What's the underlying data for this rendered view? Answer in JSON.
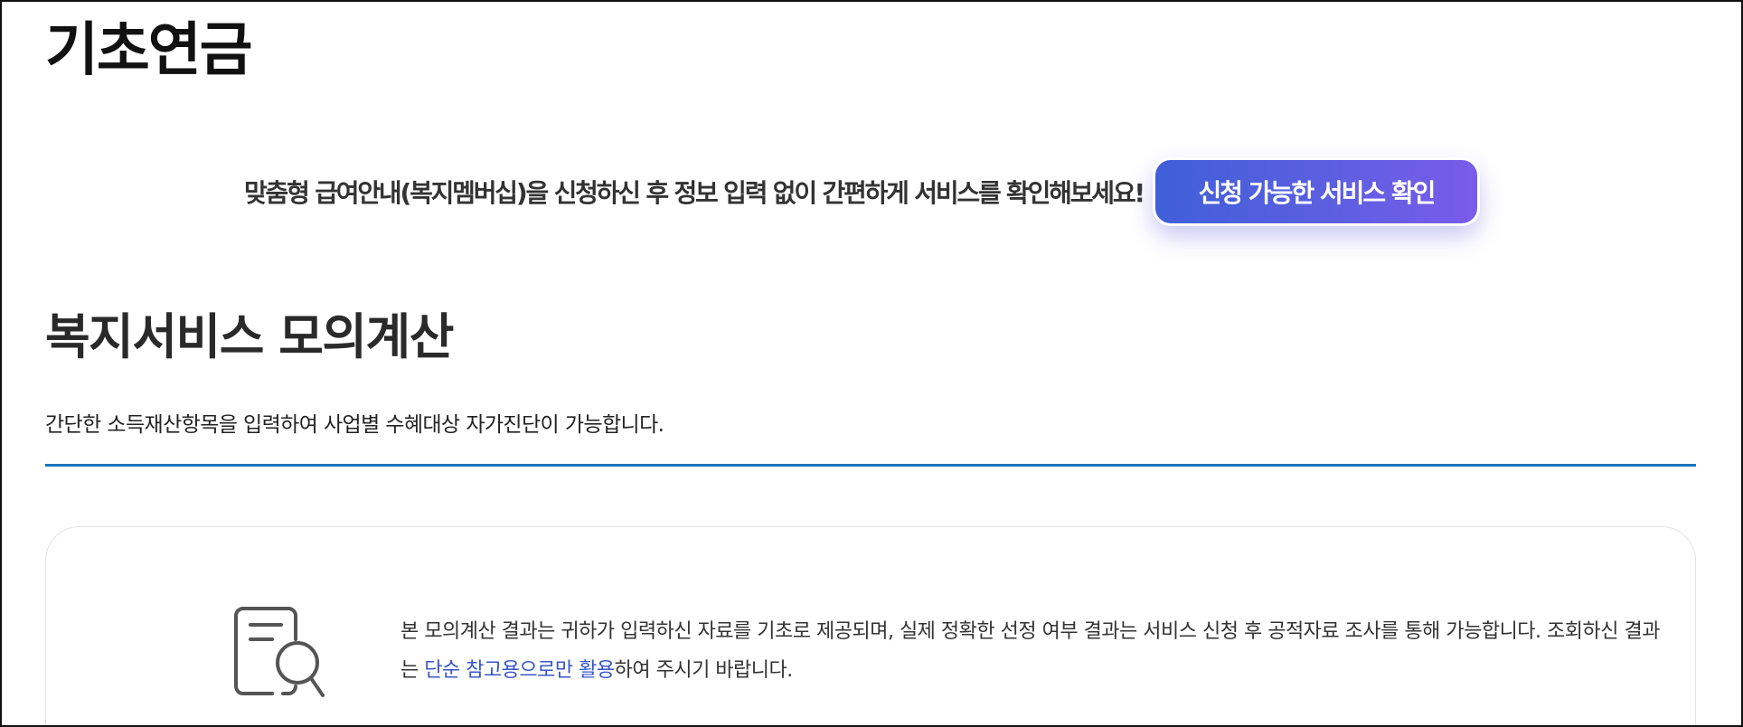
{
  "header": {
    "title": "기초연금"
  },
  "promo": {
    "message": "맞춤형 급여안내(복지멤버십)을 신청하신 후 정보 입력 없이 간편하게 서비스를 확인해보세요!",
    "button_label": "신청 가능한 서비스 확인"
  },
  "section": {
    "title": "복지서비스 모의계산",
    "description": "간단한 소득재산항목을 입력하여 사업별 수혜대상 자가진단이 가능합니다."
  },
  "notice": {
    "icon": "document-search-icon",
    "text_part1": "본 모의계산 결과는 귀하가 입력하신 자료를 기초로 제공되며, 실제 정확한 선정 여부 결과는 서비스 신청 후 공적자료 조사를 통해 가능합니다. 조회하신 결과는 ",
    "highlight": "단순 참고용으로만 활용",
    "text_part2": "하여 주시기 바랍니다."
  },
  "colors": {
    "accent_blue": "#1a73bd",
    "button_gradient_start": "#3f5fd8",
    "button_gradient_end": "#7a5cea",
    "highlight_text": "#3856c8"
  }
}
